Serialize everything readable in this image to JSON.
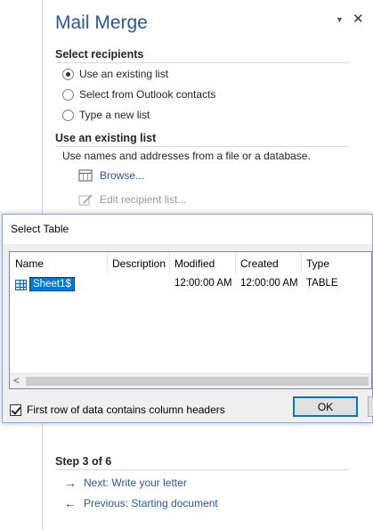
{
  "pane": {
    "title": "Mail Merge",
    "pin_icon": "dropdown-triangle-icon",
    "close_icon": "close-icon"
  },
  "select_recipients": {
    "heading": "Select recipients",
    "options": [
      {
        "label": "Use an existing list",
        "checked": true
      },
      {
        "label": "Select from Outlook contacts",
        "checked": false
      },
      {
        "label": "Type a new list",
        "checked": false
      }
    ]
  },
  "existing_list": {
    "heading": "Use an existing list",
    "description": "Use names and addresses from a file or a database.",
    "browse_label": "Browse...",
    "edit_label": "Edit recipient list..."
  },
  "dialog": {
    "title": "Select Table",
    "columns": [
      "Name",
      "Description",
      "Modified",
      "Created",
      "Type"
    ],
    "rows": [
      {
        "name": "Sheet1$",
        "description": "",
        "modified": "12:00:00 AM",
        "created": "12:00:00 AM",
        "type": "TABLE",
        "selected": true
      }
    ],
    "checkbox_label": "First row of data contains column headers",
    "checkbox_checked": true,
    "ok_label": "OK"
  },
  "step": {
    "heading": "Step 3 of 6",
    "next_label": "Next: Write your letter",
    "previous_label": "Previous: Starting document"
  },
  "colors": {
    "accent": "#2b579a",
    "selection": "#0078d7"
  }
}
